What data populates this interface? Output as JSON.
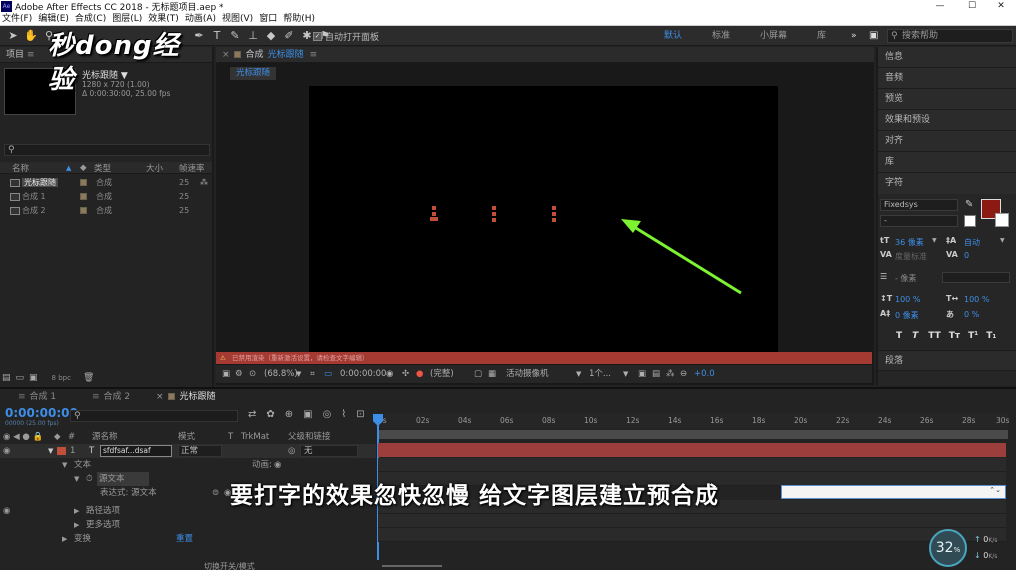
{
  "window": {
    "title": "Adobe After Effects CC 2018 - 无标题项目.aep *",
    "app_badge": "Ae",
    "minimize": "—",
    "maximize": "☐",
    "close": "✕"
  },
  "menu": [
    "文件(F)",
    "编辑(E)",
    "合成(C)",
    "图层(L)",
    "效果(T)",
    "动画(A)",
    "视图(V)",
    "窗口",
    "帮助(H)"
  ],
  "toolbar": {
    "auto_open": "自动打开面板",
    "workspaces": [
      "默认",
      "标准",
      "小屏幕",
      "库"
    ],
    "active_workspace": "默认",
    "search_placeholder": "搜索帮助",
    "more": "»"
  },
  "watermark": "秒dong经验",
  "project": {
    "tab": "项目",
    "comp_name": "光标跟随 ▼",
    "comp_info1": "1280 x 720 (1.00)",
    "comp_info2": "Δ 0:00:30:00, 25.00 fps",
    "search_icon": "⚲",
    "columns": [
      "名称",
      "类型",
      "大小",
      "帧速率"
    ],
    "items": [
      {
        "name": "光标跟随",
        "type": "合成",
        "fps": "25"
      },
      {
        "name": "合成 1",
        "type": "合成",
        "fps": "25"
      },
      {
        "name": "合成 2",
        "type": "合成",
        "fps": "25"
      }
    ],
    "bpc": "8 bpc"
  },
  "composition": {
    "tab_label": "合成",
    "tab_name": "光标跟随",
    "sub_tab": "光标跟随",
    "warning": "已禁用渲染（重新激活设置，请检查文字编辑）",
    "zoom": "(68.8%)",
    "timecode": "0:00:00:00",
    "resolution": "(完整)",
    "camera": "活动摄像机",
    "views": "1个...",
    "exposure": "+0.0"
  },
  "right_panels": {
    "items": [
      "信息",
      "音频",
      "预览",
      "效果和预设",
      "对齐",
      "库"
    ],
    "character": {
      "title": "字符",
      "font": "Fixedsys",
      "style": "-",
      "size": "36 像素",
      "leading": "自动",
      "tracking_label": "度量标准",
      "tracking": "0",
      "stroke": "- 像素",
      "vscale": "100 %",
      "hscale": "100 %",
      "baseline": "0 像素",
      "tsume": "0 %",
      "styles": [
        "T",
        "T",
        "TT",
        "Tт",
        "T¹",
        "T₁"
      ]
    },
    "paragraph": "段落",
    "fill_color": "#8b1a12"
  },
  "timeline": {
    "tabs": [
      "合成 1",
      "合成 2",
      "光标跟随"
    ],
    "timecode": "0:00:00:00",
    "fps_sub": "00000 (25.00 fps)",
    "columns": [
      "源名称",
      "模式",
      "T",
      "TrkMat",
      "父级和链接"
    ],
    "layer": {
      "num": "1",
      "name": "sfdfsaf...dsaf",
      "mode": "正常",
      "parent": "无"
    },
    "props": [
      "文本",
      "源文本",
      "表达式: 源文本",
      "路径选项",
      "更多选项",
      "变换"
    ],
    "anim_label": "动画:",
    "reset_label": "重置",
    "toggle_label": "切换开关/模式",
    "ruler_ticks": [
      "0s",
      "02s",
      "04s",
      "06s",
      "08s",
      "10s",
      "12s",
      "14s",
      "16s",
      "18s",
      "20s",
      "22s",
      "24s",
      "26s",
      "28s",
      "30s"
    ]
  },
  "subtitle": "要打字的效果忽快忽慢  给文字图层建立预合成",
  "network": {
    "speed": "32",
    "unit": "%",
    "up": "0",
    "down": "0",
    "rate": "K/s"
  }
}
